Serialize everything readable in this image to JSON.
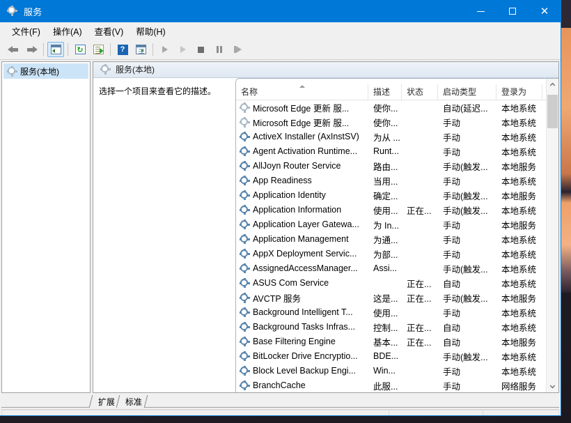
{
  "window": {
    "title": "服务",
    "title_icon": "gear-icon",
    "controls": {
      "minimize": "—",
      "maximize": "□",
      "close": "✕"
    }
  },
  "menu": {
    "items": [
      {
        "label": "文件(F)",
        "name": "menu-file"
      },
      {
        "label": "操作(A)",
        "name": "menu-action"
      },
      {
        "label": "查看(V)",
        "name": "menu-view"
      },
      {
        "label": "帮助(H)",
        "name": "menu-help"
      }
    ]
  },
  "toolbar": {
    "items": [
      {
        "name": "back-button",
        "icon": "arrow-left-icon"
      },
      {
        "name": "forward-button",
        "icon": "arrow-right-icon"
      },
      {
        "name": "show-hide-console-tree-button",
        "icon": "panel-left-icon"
      },
      {
        "name": "refresh-button",
        "icon": "refresh-icon"
      },
      {
        "name": "export-list-button",
        "icon": "export-icon"
      },
      {
        "name": "help-button",
        "icon": "question-mark-icon"
      },
      {
        "name": "properties-button",
        "icon": "panel-right-icon"
      },
      {
        "name": "start-service-button",
        "icon": "play-icon"
      },
      {
        "name": "resume-service-button",
        "icon": "play-outline-icon"
      },
      {
        "name": "stop-service-button",
        "icon": "stop-icon"
      },
      {
        "name": "pause-service-button",
        "icon": "pause-icon"
      },
      {
        "name": "restart-service-button",
        "icon": "restart-icon"
      }
    ]
  },
  "tree": {
    "items": [
      {
        "label": "服务(本地)",
        "icon": "gear-icon",
        "selected": true
      }
    ]
  },
  "detail": {
    "header": "服务(本地)",
    "header_icon": "gear-icon",
    "hint": "选择一个项目来查看它的描述。"
  },
  "list": {
    "columns": [
      {
        "key": "name",
        "label": "名称",
        "sorted": true
      },
      {
        "key": "desc",
        "label": "描述",
        "sorted": false
      },
      {
        "key": "status",
        "label": "状态",
        "sorted": false
      },
      {
        "key": "start",
        "label": "启动类型",
        "sorted": false
      },
      {
        "key": "logon",
        "label": "登录为",
        "sorted": false
      }
    ],
    "rows": [
      {
        "name": "Microsoft Edge 更新 服...",
        "desc": "使你...",
        "status": "",
        "start": "自动(延迟...",
        "logon": "本地系统",
        "icon_pale": true
      },
      {
        "name": "Microsoft Edge 更新 服...",
        "desc": "使你...",
        "status": "",
        "start": "手动",
        "logon": "本地系统",
        "icon_pale": true
      },
      {
        "name": "ActiveX Installer (AxInstSV)",
        "desc": "为从 ...",
        "status": "",
        "start": "手动",
        "logon": "本地系统",
        "icon_pale": false
      },
      {
        "name": "Agent Activation Runtime...",
        "desc": "Runt...",
        "status": "",
        "start": "手动",
        "logon": "本地系统",
        "icon_pale": false
      },
      {
        "name": "AllJoyn Router Service",
        "desc": "路由...",
        "status": "",
        "start": "手动(触发...",
        "logon": "本地服务",
        "icon_pale": false
      },
      {
        "name": "App Readiness",
        "desc": "当用...",
        "status": "",
        "start": "手动",
        "logon": "本地系统",
        "icon_pale": false
      },
      {
        "name": "Application Identity",
        "desc": "确定...",
        "status": "",
        "start": "手动(触发...",
        "logon": "本地服务",
        "icon_pale": false
      },
      {
        "name": "Application Information",
        "desc": "使用...",
        "status": "正在...",
        "start": "手动(触发...",
        "logon": "本地系统",
        "icon_pale": false
      },
      {
        "name": "Application Layer Gatewa...",
        "desc": "为 In...",
        "status": "",
        "start": "手动",
        "logon": "本地服务",
        "icon_pale": false
      },
      {
        "name": "Application Management",
        "desc": "为通...",
        "status": "",
        "start": "手动",
        "logon": "本地系统",
        "icon_pale": false
      },
      {
        "name": "AppX Deployment Servic...",
        "desc": "为部...",
        "status": "",
        "start": "手动",
        "logon": "本地系统",
        "icon_pale": false
      },
      {
        "name": "AssignedAccessManager...",
        "desc": "Assi...",
        "status": "",
        "start": "手动(触发...",
        "logon": "本地系统",
        "icon_pale": false
      },
      {
        "name": "ASUS Com Service",
        "desc": "",
        "status": "正在...",
        "start": "自动",
        "logon": "本地系统",
        "icon_pale": false
      },
      {
        "name": "AVCTP 服务",
        "desc": "这是...",
        "status": "正在...",
        "start": "手动(触发...",
        "logon": "本地服务",
        "icon_pale": false
      },
      {
        "name": "Background Intelligent T...",
        "desc": "使用...",
        "status": "",
        "start": "手动",
        "logon": "本地系统",
        "icon_pale": false
      },
      {
        "name": "Background Tasks Infras...",
        "desc": "控制...",
        "status": "正在...",
        "start": "自动",
        "logon": "本地系统",
        "icon_pale": false
      },
      {
        "name": "Base Filtering Engine",
        "desc": "基本...",
        "status": "正在...",
        "start": "自动",
        "logon": "本地服务",
        "icon_pale": false
      },
      {
        "name": "BitLocker Drive Encryptio...",
        "desc": "BDE...",
        "status": "",
        "start": "手动(触发...",
        "logon": "本地系统",
        "icon_pale": false
      },
      {
        "name": "Block Level Backup Engi...",
        "desc": "Win...",
        "status": "",
        "start": "手动",
        "logon": "本地系统",
        "icon_pale": false
      },
      {
        "name": "BranchCache",
        "desc": "此服...",
        "status": "",
        "start": "手动",
        "logon": "网络服务",
        "icon_pale": false
      }
    ],
    "scrollbar": {
      "up_glyph": "︿",
      "down_glyph": "﹀"
    }
  },
  "tabs": [
    {
      "label": "扩展",
      "name": "tab-extended",
      "active": false
    },
    {
      "label": "标准",
      "name": "tab-standard",
      "active": true
    }
  ],
  "statusbar": {
    "main": "",
    "pane_a": "",
    "pane_b": ""
  },
  "colors": {
    "titlebar": "#0078d7",
    "accent_border": "#0a7cd1",
    "selection": "#cce4f7",
    "window_bg": "#f0f0f0"
  }
}
